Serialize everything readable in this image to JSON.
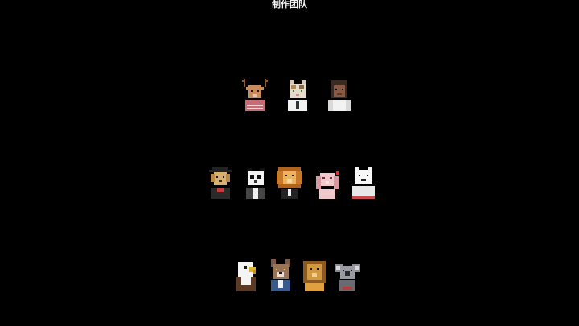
{
  "screen": {
    "title": "制作团队"
  },
  "team_rows": [
    {
      "members": [
        {
          "icon": "deer-avatar-icon"
        },
        {
          "icon": "cat-avatar-icon"
        },
        {
          "icon": "hooded-person-avatar-icon"
        }
      ]
    },
    {
      "members": [
        {
          "icon": "dog-with-hat-avatar-icon"
        },
        {
          "icon": "panda-avatar-icon"
        },
        {
          "icon": "lion-avatar-icon"
        },
        {
          "icon": "rabbit-avatar-icon"
        },
        {
          "icon": "polar-bear-avatar-icon"
        }
      ]
    },
    {
      "members": [
        {
          "icon": "eagle-avatar-icon"
        },
        {
          "icon": "wolf-avatar-icon"
        },
        {
          "icon": "lion-cub-avatar-icon"
        },
        {
          "icon": "koala-avatar-icon"
        }
      ]
    }
  ],
  "colors": {
    "background": "#000000",
    "title_text": "#f2f2f2"
  }
}
